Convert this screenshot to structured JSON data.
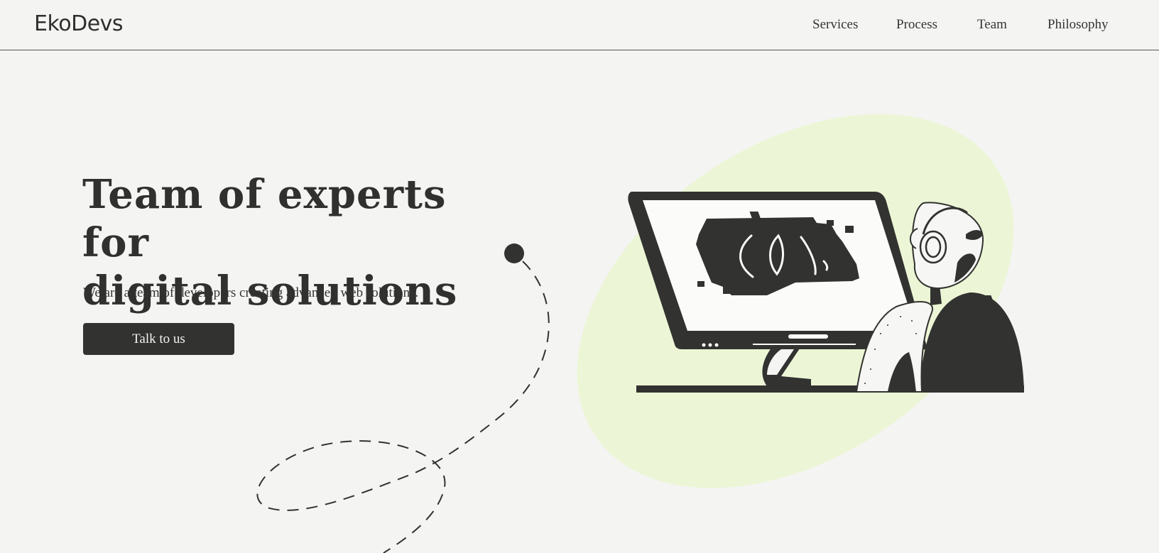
{
  "header": {
    "logo": "EkoDevs",
    "nav": [
      "Services",
      "Process",
      "Team",
      "Philosophy"
    ]
  },
  "hero": {
    "title_line1": "Team of experts for",
    "title_line2": "digital solutions",
    "subtitle": "We are a team of developers creating advanced web solutions.",
    "cta_label": "Talk to us"
  },
  "colors": {
    "background": "#f4f4f3",
    "ink": "#323230",
    "accent_blob": "#ecf6d6"
  },
  "illustration": {
    "icon": "developer-at-monitor-illustration"
  }
}
